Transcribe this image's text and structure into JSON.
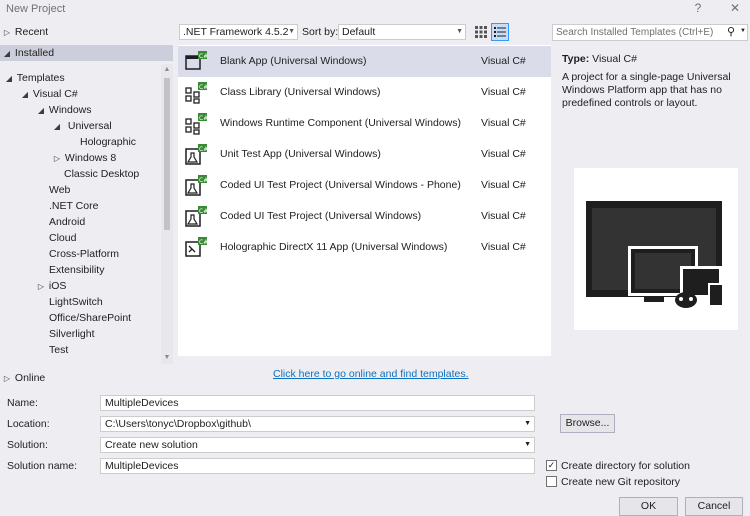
{
  "window": {
    "title": "New Project",
    "help": "?",
    "close": "✕"
  },
  "tree": {
    "recent": "Recent",
    "installed": "Installed",
    "templates": "Templates",
    "visual_csharp": "Visual C#",
    "windows": "Windows",
    "universal": "Universal",
    "holographic": "Holographic",
    "windows8": "Windows 8",
    "classic_desktop": "Classic Desktop",
    "web": "Web",
    "netcore": ".NET Core",
    "android": "Android",
    "cloud": "Cloud",
    "cross_platform": "Cross-Platform",
    "extensibility": "Extensibility",
    "ios": "iOS",
    "lightswitch": "LightSwitch",
    "office_sharepoint": "Office/SharePoint",
    "silverlight": "Silverlight",
    "test": "Test",
    "online": "Online"
  },
  "toolbar": {
    "framework": ".NET Framework 4.5.2",
    "sort_label": "Sort by:",
    "sort_value": "Default",
    "search_placeholder": "Search Installed Templates (Ctrl+E)"
  },
  "templates": [
    {
      "name": "Blank App (Universal Windows)",
      "lang": "Visual C#",
      "icon": "blank-app-icon"
    },
    {
      "name": "Class Library (Universal Windows)",
      "lang": "Visual C#",
      "icon": "class-library-icon"
    },
    {
      "name": "Windows Runtime Component (Universal Windows)",
      "lang": "Visual C#",
      "icon": "runtime-component-icon"
    },
    {
      "name": "Unit Test App (Universal Windows)",
      "lang": "Visual C#",
      "icon": "unit-test-icon"
    },
    {
      "name": "Coded UI Test Project (Universal Windows - Phone)",
      "lang": "Visual C#",
      "icon": "coded-ui-test-icon"
    },
    {
      "name": "Coded UI Test Project (Universal Windows)",
      "lang": "Visual C#",
      "icon": "coded-ui-test-icon"
    },
    {
      "name": "Holographic DirectX 11 App (Universal Windows)",
      "lang": "Visual C#",
      "icon": "holographic-app-icon"
    }
  ],
  "details": {
    "type_label": "Type:",
    "type_value": "Visual C#",
    "description": "A project for a single-page Universal Windows Platform app that has no predefined controls or layout."
  },
  "online_link": "Click here to go online and find templates.",
  "form": {
    "name_label": "Name:",
    "name_value": "MultipleDevices",
    "location_label": "Location:",
    "location_value": "C:\\Users\\tonyc\\Dropbox\\github\\",
    "solution_label": "Solution:",
    "solution_value": "Create new solution",
    "solution_name_label": "Solution name:",
    "solution_name_value": "MultipleDevices",
    "browse": "Browse...",
    "create_dir": "Create directory for solution",
    "create_dir_checked": true,
    "create_git": "Create new Git repository",
    "create_git_checked": false,
    "ok": "OK",
    "cancel": "Cancel"
  }
}
